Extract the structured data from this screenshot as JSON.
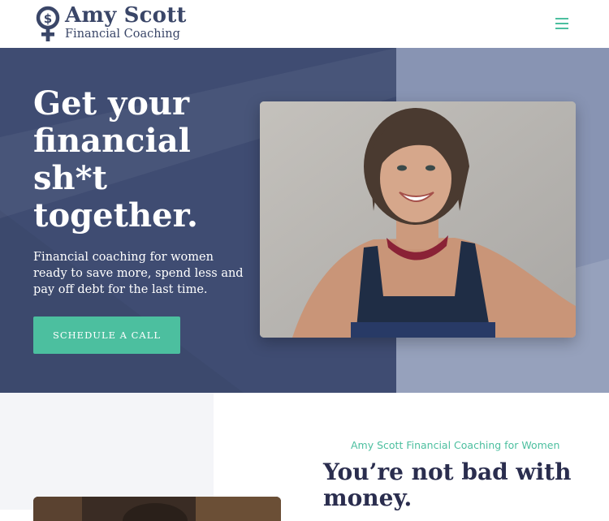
{
  "header": {
    "brand_name": "Amy Scott",
    "brand_tagline": "Financial Coaching",
    "logo_symbol": "$",
    "menu_icon": "hamburger-icon",
    "accent_color": "#4cbf9f"
  },
  "hero": {
    "title": "Get your financial sh*t together.",
    "subtitle": "Financial coaching for women ready to save more, spend less and pay off debt for the last time.",
    "cta_label": "SCHEDULE A CALL",
    "bg_color": "#3f4c72",
    "side_color": "#8894b3"
  },
  "intro": {
    "eyebrow": "Amy Scott Financial Coaching for Women",
    "heading": "You’re not bad with money."
  }
}
